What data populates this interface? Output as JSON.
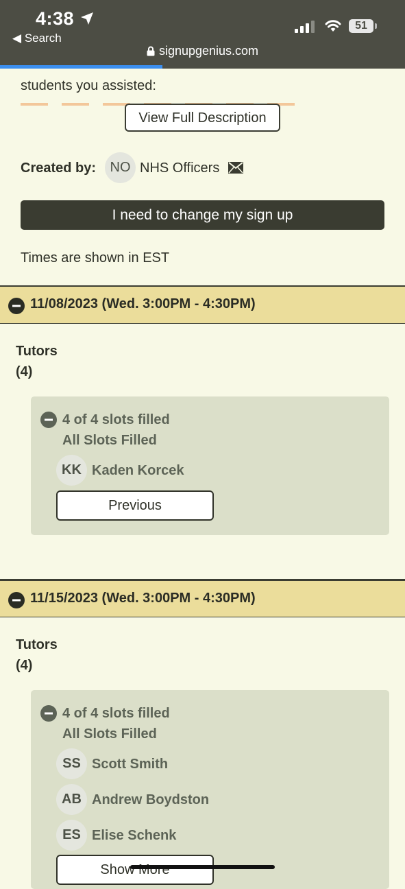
{
  "status_bar": {
    "time": "4:38",
    "back_label": "Search",
    "battery": "51",
    "url": "signupgenius.com"
  },
  "content": {
    "truncated_text": "students you assisted:",
    "view_desc_button": "View Full Description",
    "created_by_label": "Created by:",
    "creator_initials": "NO",
    "creator_name": "NHS Officers",
    "change_signup_button": "I need to change my sign up",
    "timezone_note": "Times are shown in EST"
  },
  "sections": [
    {
      "date": "11/08/2023 (Wed. 3:00PM - 4:30PM)",
      "role": "Tutors",
      "count": "(4)",
      "slots_filled": "4 of 4 slots filled",
      "status": "All Slots Filled",
      "people": [
        {
          "initials": "KK",
          "name": "Kaden Korcek"
        }
      ],
      "button": "Previous"
    },
    {
      "date": "11/15/2023 (Wed. 3:00PM - 4:30PM)",
      "role": "Tutors",
      "count": "(4)",
      "slots_filled": "4 of 4 slots filled",
      "status": "All Slots Filled",
      "people": [
        {
          "initials": "SS",
          "name": "Scott Smith"
        },
        {
          "initials": "AB",
          "name": "Andrew Boydston"
        },
        {
          "initials": "ES",
          "name": "Elise Schenk"
        }
      ],
      "button": "Show More"
    }
  ],
  "colors": {
    "page_bg": "#f8f9e6",
    "date_bar": "#ebdd9b",
    "slot_box": "#dbdfc9",
    "dark": "#3a3c31",
    "progress": "#3b8ff0"
  }
}
